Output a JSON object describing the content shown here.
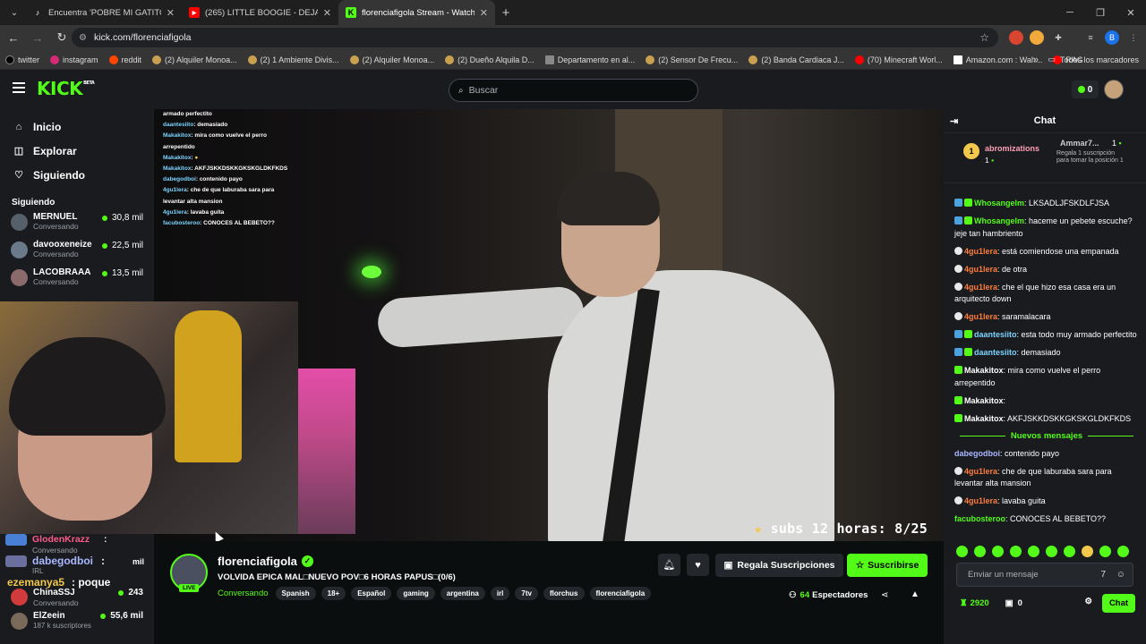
{
  "browser": {
    "tabs": [
      {
        "title": "Encuentra 'POBRE MI GATITO' en",
        "icon": "tiktok-icon"
      },
      {
        "title": "(265) LITTLE BOOGIE - DEJA DE",
        "icon": "youtube-icon"
      },
      {
        "title": "florenciafigola Stream - Watch",
        "icon": "kick-icon"
      }
    ],
    "url": "kick.com/florenciafigola",
    "bookmarks": [
      "twitter",
      "instagram",
      "reddit",
      "(2) Alquiler Monoa...",
      "(2) 1 Ambiente Divis...",
      "(2) Alquiler Monoa...",
      "(2) Dueño Alquila D...",
      "Departamento en al...",
      "(2) Sensor De Frecu...",
      "(2) Banda Cardiaca J...",
      "(70) Minecraft Worl...",
      "Amazon.com : Wah...",
      "RAG"
    ],
    "bookmarks_more": "»",
    "all_bookmarks": "Todos los marcadores",
    "profile_letter": "B"
  },
  "header": {
    "logo": "KICK",
    "logo_tag": "BETA",
    "search_placeholder": "Buscar",
    "kicks_count": "0"
  },
  "sidebar": {
    "nav": [
      {
        "label": "Inicio",
        "icon": "home-icon"
      },
      {
        "label": "Explorar",
        "icon": "compass-icon"
      },
      {
        "label": "Siguiendo",
        "icon": "heart-icon"
      }
    ],
    "section_title": "Siguiendo",
    "channels": [
      {
        "name": "MERNUEL",
        "category": "Conversando",
        "viewers": "30,8 mil"
      },
      {
        "name": "davooxeneize",
        "category": "Conversando",
        "viewers": "22,5 mil"
      },
      {
        "name": "LACOBRAAA",
        "category": "Conversando",
        "viewers": "13,5 mil"
      }
    ]
  },
  "video": {
    "overlay_text": "subs 12 horas: 8/25",
    "overlay_chat": [
      {
        "user": "",
        "text": "armado perfectito"
      },
      {
        "user": "daantesiito",
        "text": ": demasiado"
      },
      {
        "user": "Makakitox",
        "text": ": mira como vuelve el perro arrepentido"
      },
      {
        "user": "Makakitox",
        "text": ":"
      },
      {
        "user": "Makakitox",
        "text": ": AKFJSKKDSKKGKSKGLDKFKDS"
      },
      {
        "user": "dabegodboi",
        "text": ": contenido payo"
      },
      {
        "user": "4gu1lera",
        "text": ": che de que laburaba sara para levantar alta mansion"
      },
      {
        "user": "4gu1lera",
        "text": ": lavaba guita"
      },
      {
        "user": "facubosteroo",
        "text": ": CONOCES AL BEBETO??"
      }
    ]
  },
  "left_overlay_chat": [
    {
      "user": "GlodenKrazz",
      "text": ":",
      "sub": "Conversando",
      "viewers": ""
    },
    {
      "user": "dabegodboi",
      "text": ":",
      "sub": "IRL",
      "viewers": "mil"
    },
    {
      "user": "ezemanya5",
      "text": ": poque",
      "sub": "",
      "viewers": ""
    },
    {
      "user": "ChinaSSJ",
      "text": "",
      "sub": "Conversando",
      "viewers": "243"
    },
    {
      "user": "ElZeein",
      "text": "",
      "sub": "187 k suscriptores",
      "viewers": "55,6 mil"
    }
  ],
  "stream": {
    "streamer": "florenciafigola",
    "live_label": "LIVE",
    "title": "VOLVIDA EPICA MAL□NUEVO POV□6 HORAS PAPUS□(0/6)",
    "category": "Conversando",
    "tags": [
      "Spanish",
      "18+",
      "Español",
      "gaming",
      "argentina",
      "irl",
      "7tv",
      "florchus",
      "florenciafigola"
    ],
    "gift_label": "Regala Suscripciones",
    "subscribe_label": "Suscribirse",
    "viewers": "64",
    "viewers_label": "Espectadores"
  },
  "chat": {
    "title": "Chat",
    "pinned_gifter": {
      "rank": "1",
      "name": "abromizations",
      "count": "1"
    },
    "pinned_next": {
      "name": "Ammar7...",
      "count": "1",
      "text": "Regala 1 suscripción para tomar la posición 1"
    },
    "messages": [
      {
        "user": "Whosangelm",
        "text": ": LKSADLJFSKDLFJSA",
        "color": "#53fc18",
        "badges": [
          "b2",
          "b0"
        ]
      },
      {
        "user": "Whosangelm",
        "text": ": haceme un pebete escuche? jeje tan hambriento",
        "color": "#53fc18",
        "badges": [
          "b2",
          "b0"
        ]
      },
      {
        "user": "4gu1lera",
        "text": ": está comiendose una empanada",
        "color": "#ff7d3a",
        "badges": [
          "b3"
        ]
      },
      {
        "user": "4gu1lera",
        "text": ": de otra",
        "color": "#ff7d3a",
        "badges": [
          "b3"
        ]
      },
      {
        "user": "4gu1lera",
        "text": ": che el que hizo esa casa era un arquitecto down",
        "color": "#ff7d3a",
        "badges": [
          "b3"
        ]
      },
      {
        "user": "4gu1lera",
        "text": ": saramalacara",
        "color": "#ff7d3a",
        "badges": [
          "b3"
        ]
      },
      {
        "user": "daantesiito",
        "text": ": esta todo muy armado perfectito",
        "color": "#7bd3ff",
        "badges": [
          "b2",
          "b0"
        ]
      },
      {
        "user": "daantesiito",
        "text": ": demasiado",
        "color": "#7bd3ff",
        "badges": [
          "b2",
          "b0"
        ]
      },
      {
        "user": "Makakitox",
        "text": ": mira como vuelve el perro arrepentido",
        "color": "#ffffff",
        "badges": [
          "b0"
        ]
      },
      {
        "user": "Makakitox",
        "text": ":",
        "color": "#ffffff",
        "badges": [
          "b0"
        ]
      },
      {
        "user": "Makakitox",
        "text": ": AKFJSKKDSKKGKSKGLDKFKDS",
        "color": "#ffffff",
        "badges": [
          "b0"
        ]
      }
    ],
    "new_messages_label": "Nuevos mensajes",
    "new_messages": [
      {
        "user": "dabegodboi",
        "text": ": contenido payo",
        "color": "#a9b8ff",
        "badges": []
      },
      {
        "user": "4gu1lera",
        "text": ": che de que laburaba sara para levantar alta mansion",
        "color": "#ff7d3a",
        "badges": [
          "b3"
        ]
      },
      {
        "user": "4gu1lera",
        "text": ": lavaba guita",
        "color": "#ff7d3a",
        "badges": [
          "b3"
        ]
      },
      {
        "user": "facubosteroo",
        "text": ": CONOCES AL BEBETO??",
        "color": "#53fc18",
        "badges": []
      }
    ],
    "input_placeholder": "Enviar un mensaje",
    "points": "2920",
    "gifts": "0",
    "send_label": "Chat"
  }
}
